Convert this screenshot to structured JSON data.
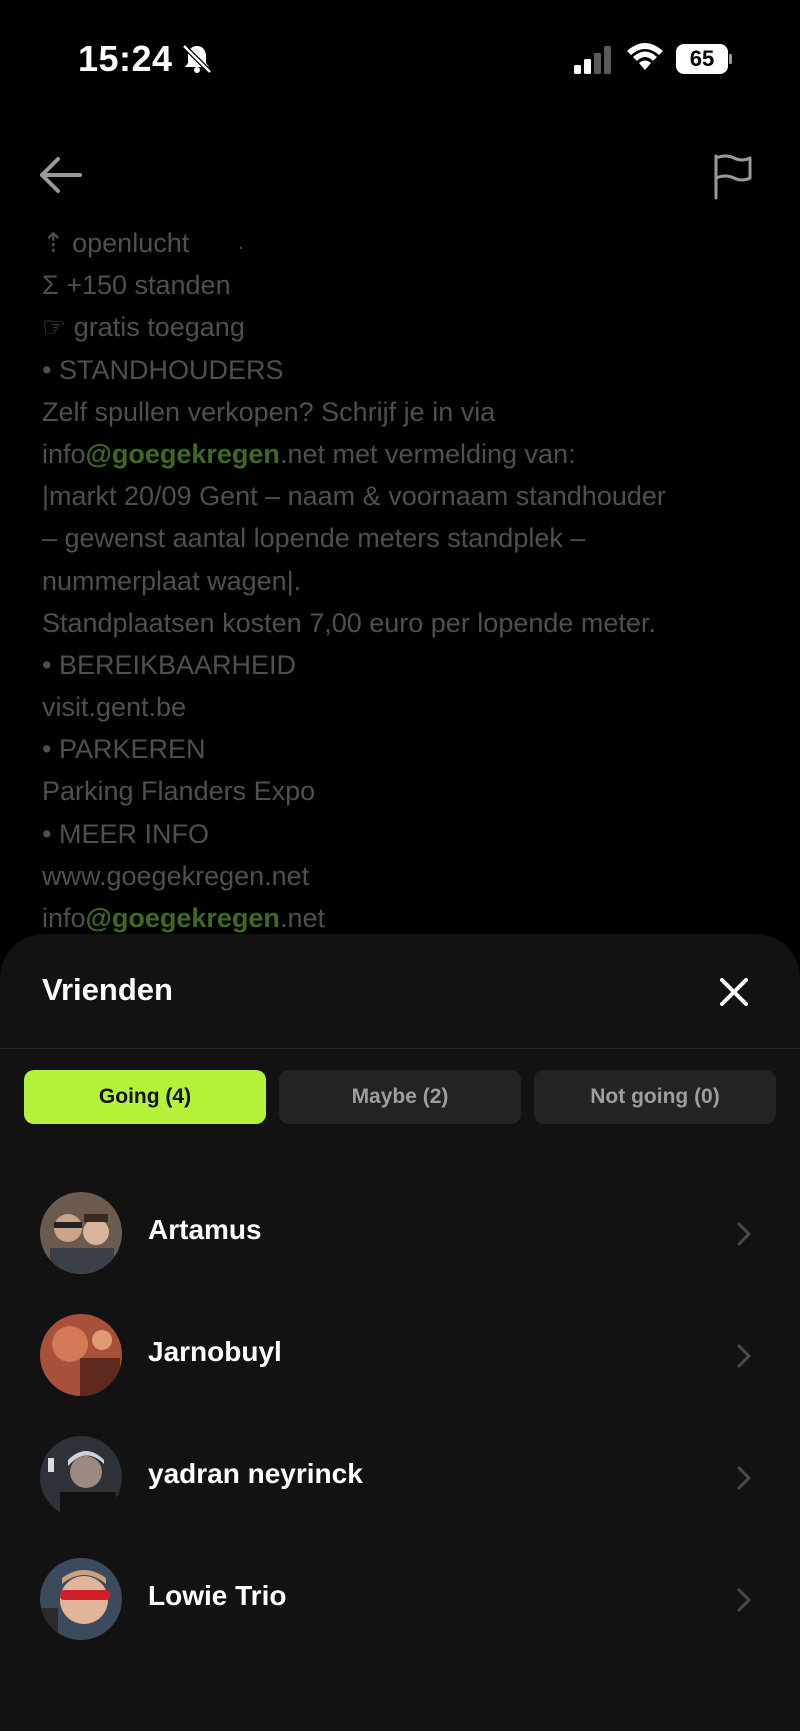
{
  "status_bar": {
    "time": "15:24",
    "battery": "65"
  },
  "description": {
    "lines": [
      {
        "parts": [
          {
            "text": "⇡ openlucht"
          }
        ]
      },
      {
        "parts": [
          {
            "text": "Σ +150 standen"
          }
        ]
      },
      {
        "parts": [
          {
            "text": "☞ gratis toegang"
          }
        ]
      },
      {
        "parts": [
          {
            "text": "• STANDHOUDERS"
          }
        ]
      },
      {
        "parts": [
          {
            "text": "Zelf spullen verkopen? Schrijf je in via"
          }
        ]
      },
      {
        "parts": [
          {
            "text": "info"
          },
          {
            "text": "@goegekregen",
            "green": true
          },
          {
            "text": ".net met vermelding van:"
          }
        ]
      },
      {
        "parts": [
          {
            "text": "|markt 20/09 Gent – naam & voornaam standhouder"
          }
        ]
      },
      {
        "parts": [
          {
            "text": "– gewenst aantal lopende meters standplek –"
          }
        ]
      },
      {
        "parts": [
          {
            "text": "nummerplaat wagen|."
          }
        ]
      },
      {
        "parts": [
          {
            "text": "Standplaatsen kosten 7,00 euro per lopende meter."
          }
        ]
      },
      {
        "parts": [
          {
            "text": "• BEREIKBAARHEID"
          }
        ]
      },
      {
        "parts": [
          {
            "text": "visit.gent.be"
          }
        ]
      },
      {
        "parts": [
          {
            "text": "• PARKEREN"
          }
        ]
      },
      {
        "parts": [
          {
            "text": "Parking Flanders Expo"
          }
        ]
      },
      {
        "parts": [
          {
            "text": "• MEER INFO"
          }
        ]
      },
      {
        "parts": [
          {
            "text": "www.goegekregen.net"
          }
        ]
      },
      {
        "parts": [
          {
            "text": "info"
          },
          {
            "text": "@goegekregen",
            "green": true
          },
          {
            "text": ".net"
          }
        ]
      }
    ]
  },
  "sheet": {
    "title": "Vrienden",
    "tabs": [
      {
        "label": "Going (4)",
        "active": true
      },
      {
        "label": "Maybe (2)",
        "active": false
      },
      {
        "label": "Not going (0)",
        "active": false
      }
    ],
    "friends": [
      {
        "name": "Artamus"
      },
      {
        "name": "Jarnobuyl"
      },
      {
        "name": "yadran neyrinck"
      },
      {
        "name": "Lowie Trio"
      }
    ]
  },
  "colors": {
    "accent": "#b5f23a",
    "sheet_bg": "#121212",
    "tab_bg": "#232323"
  }
}
